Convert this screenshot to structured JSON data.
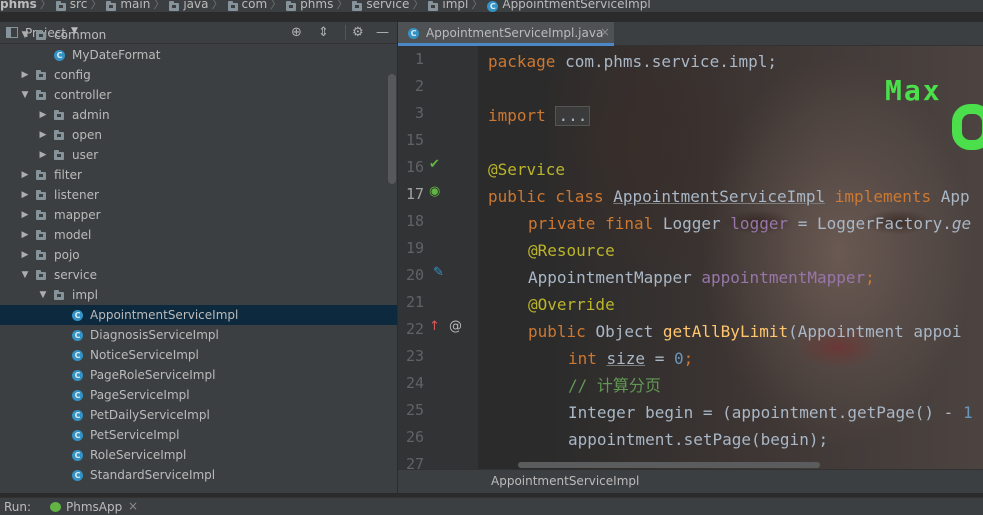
{
  "breadcrumb": [
    "phms",
    "src",
    "main",
    "java",
    "com",
    "phms",
    "service",
    "impl",
    "AppointmentServiceImpl"
  ],
  "project_panel": {
    "title": "Project",
    "dropdown_icon": "triangle-down",
    "header_icons": [
      "crosshair-icon",
      "collapse-icon",
      "gear-icon",
      "minimize-icon"
    ],
    "tree": [
      {
        "label": "common",
        "type": "folder",
        "depth": 2,
        "expanded": true
      },
      {
        "label": "MyDateFormat",
        "type": "class",
        "depth": 3
      },
      {
        "label": "config",
        "type": "folder",
        "depth": 2,
        "expanded": false
      },
      {
        "label": "controller",
        "type": "folder",
        "depth": 2,
        "expanded": true
      },
      {
        "label": "admin",
        "type": "folder",
        "depth": 3,
        "expanded": false
      },
      {
        "label": "open",
        "type": "folder",
        "depth": 3,
        "expanded": false
      },
      {
        "label": "user",
        "type": "folder",
        "depth": 3,
        "expanded": false
      },
      {
        "label": "filter",
        "type": "folder",
        "depth": 2,
        "expanded": false
      },
      {
        "label": "listener",
        "type": "folder",
        "depth": 2,
        "expanded": false
      },
      {
        "label": "mapper",
        "type": "folder",
        "depth": 2,
        "expanded": false
      },
      {
        "label": "model",
        "type": "folder",
        "depth": 2,
        "expanded": false
      },
      {
        "label": "pojo",
        "type": "folder",
        "depth": 2,
        "expanded": false
      },
      {
        "label": "service",
        "type": "folder",
        "depth": 2,
        "expanded": true
      },
      {
        "label": "impl",
        "type": "folder",
        "depth": 3,
        "expanded": true
      },
      {
        "label": "AppointmentServiceImpl",
        "type": "class",
        "depth": 4,
        "selected": true
      },
      {
        "label": "DiagnosisServiceImpl",
        "type": "class",
        "depth": 4
      },
      {
        "label": "NoticeServiceImpl",
        "type": "class",
        "depth": 4
      },
      {
        "label": "PageRoleServiceImpl",
        "type": "class",
        "depth": 4
      },
      {
        "label": "PageServiceImpl",
        "type": "class",
        "depth": 4
      },
      {
        "label": "PetDailyServiceImpl",
        "type": "class",
        "depth": 4
      },
      {
        "label": "PetServiceImpl",
        "type": "class",
        "depth": 4
      },
      {
        "label": "RoleServiceImpl",
        "type": "class",
        "depth": 4
      },
      {
        "label": "StandardServiceImpl",
        "type": "class",
        "depth": 4
      }
    ]
  },
  "editor": {
    "tab_label": "AppointmentServiceImpl.java",
    "footer": "AppointmentServiceImpl",
    "line_numbers": [
      "1",
      "2",
      "3",
      "15",
      "16",
      "17",
      "18",
      "19",
      "20",
      "21",
      "22",
      "23",
      "24",
      "25",
      "26",
      "27"
    ],
    "current_line": "17",
    "tokens": {
      "l1_kw": "package",
      "l1_rest": " com.phms.service.impl;",
      "l3_kw": "import",
      "l3_fold": "...",
      "l16_ann": "@Service",
      "l17_kw": "public class ",
      "l17_name": "AppointmentServiceImpl",
      "l17_kw2": " implements ",
      "l17_rest": "App",
      "l18_kw": "private final ",
      "l18_type": "Logger ",
      "l18_fld": "logger",
      "l18_eq": " = LoggerFactory.",
      "l18_it": "ge",
      "l19_ann": "@Resource",
      "l20_type": "AppointmentMapper ",
      "l20_fld": "appointmentMapper",
      "l20_end": ";",
      "l21_ann": "@Override",
      "l22_kw": "public ",
      "l22_type": "Object ",
      "l22_fn": "getAllByLimit",
      "l22_rest": "(Appointment appoi",
      "l23_kw": "int ",
      "l23_var": "size",
      "l23_eq": " = ",
      "l23_num": "0",
      "l23_end": ";",
      "l24_cmt": "// 计算分页",
      "l25_text": "Integer begin = (appointment.getPage() - ",
      "l25_num": "1",
      "l26_text": "appointment.setPage(begin);"
    },
    "gutter_icons": [
      "spring-bean-icon",
      "spring-class-icon",
      "autowired-icon",
      "override-up-icon",
      "at-icon"
    ]
  },
  "overlay": {
    "watermark_text": "Max"
  },
  "run_bar": {
    "label": "Run:",
    "app": "PhmsApp",
    "close": "×"
  }
}
